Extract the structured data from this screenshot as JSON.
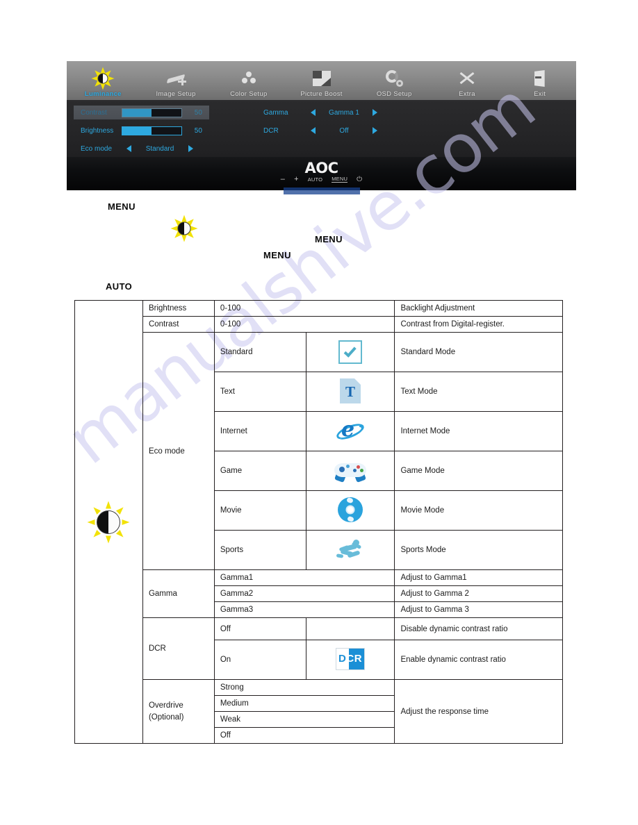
{
  "watermark": {
    "text": "manualshive.com"
  },
  "osd": {
    "tabs": [
      {
        "label": "Luminance",
        "icon": "luminance-sun-icon",
        "active": true
      },
      {
        "label": "Image Setup",
        "icon": "image-setup-icon",
        "active": false
      },
      {
        "label": "Color Setup",
        "icon": "color-setup-icon",
        "active": false
      },
      {
        "label": "Picture Boost",
        "icon": "picture-boost-icon",
        "active": false
      },
      {
        "label": "OSD Setup",
        "icon": "osd-setup-gear-icon",
        "active": false
      },
      {
        "label": "Extra",
        "icon": "extra-tools-icon",
        "active": false
      },
      {
        "label": "Exit",
        "icon": "exit-door-icon",
        "active": false
      }
    ],
    "left_column": {
      "contrast": {
        "label": "Contrast",
        "value": "50",
        "fill_percent": 50,
        "selected": true
      },
      "brightness": {
        "label": "Brightness",
        "value": "50",
        "fill_percent": 50,
        "selected": false
      },
      "eco_mode": {
        "label": "Eco mode",
        "value": "Standard",
        "selected": false
      }
    },
    "right_column": {
      "gamma": {
        "label": "Gamma",
        "value": "Gamma 1"
      },
      "dcr": {
        "label": "DCR",
        "value": "Off"
      }
    },
    "accent_color": "#2ea9e0"
  },
  "bezel": {
    "logo": "AOC",
    "buttons": [
      "–",
      "+",
      "AUTO",
      "MENU",
      "⏻"
    ]
  },
  "body_keywords": {
    "menu_1": "MENU",
    "menu_2": "MENU",
    "menu_3": "MENU",
    "auto_1": "AUTO"
  },
  "table": {
    "icon_cell": "luminance-sun-icon",
    "rows": [
      {
        "feature": "Brightness",
        "option": "0-100",
        "pic": null,
        "desc": "Backlight Adjustment"
      },
      {
        "feature": "Contrast",
        "option": "0-100",
        "pic": null,
        "desc": "Contrast from Digital-register."
      },
      {
        "feature": "Eco mode",
        "option": "Standard",
        "pic": "standard-check-icon",
        "desc": "Standard Mode"
      },
      {
        "feature": "",
        "option": "Text",
        "pic": "text-document-icon",
        "desc": "Text Mode"
      },
      {
        "feature": "",
        "option": "Internet",
        "pic": "internet-explorer-icon",
        "desc": "Internet Mode"
      },
      {
        "feature": "",
        "option": "Game",
        "pic": "gamepad-icon",
        "desc": "Game Mode"
      },
      {
        "feature": "",
        "option": "Movie",
        "pic": "movie-disc-icon",
        "desc": "Movie Mode"
      },
      {
        "feature": "",
        "option": "Sports",
        "pic": "sports-runner-icon",
        "desc": "Sports Mode"
      },
      {
        "feature": "Gamma",
        "option": "Gamma1",
        "pic": null,
        "desc": "Adjust to Gamma1"
      },
      {
        "feature": "",
        "option": "Gamma2",
        "pic": null,
        "desc": "Adjust to Gamma 2"
      },
      {
        "feature": "",
        "option": "Gamma3",
        "pic": null,
        "desc": "Adjust to Gamma 3"
      },
      {
        "feature": "DCR",
        "option": "Off",
        "pic": null,
        "desc": "Disable dynamic contrast ratio"
      },
      {
        "feature": "",
        "option": "On",
        "pic": "dcr-badge-icon",
        "desc": "Enable dynamic contrast ratio"
      },
      {
        "feature": "Overdrive (Optional)",
        "option": "Strong",
        "pic": null,
        "desc": "Adjust the response time"
      },
      {
        "feature": "",
        "option": "Medium",
        "pic": null,
        "desc": ""
      },
      {
        "feature": "",
        "option": "Weak",
        "pic": null,
        "desc": ""
      },
      {
        "feature": "",
        "option": "Off",
        "pic": null,
        "desc": ""
      }
    ],
    "labels": {
      "brightness": "Brightness",
      "contrast": "Contrast",
      "eco_mode": "Eco mode",
      "gamma": "Gamma",
      "dcr": "DCR",
      "overdrive_line1": "Overdrive",
      "overdrive_line2": "(Optional)",
      "range_0_100_a": "0-100",
      "range_0_100_b": "0-100",
      "standard": "Standard",
      "text": "Text",
      "internet": "Internet",
      "game": "Game",
      "movie": "Movie",
      "sports": "Sports",
      "gamma1": "Gamma1",
      "gamma2": "Gamma2",
      "gamma3": "Gamma3",
      "dcr_off": "Off",
      "dcr_on": "On",
      "strong": "Strong",
      "medium": "Medium",
      "weak": "Weak",
      "od_off": "Off",
      "desc_backlight": "Backlight Adjustment",
      "desc_contrast": "Contrast from Digital-register.",
      "desc_standard": "Standard Mode",
      "desc_text": "Text Mode",
      "desc_internet": "Internet Mode",
      "desc_game": "Game Mode",
      "desc_movie": "Movie Mode",
      "desc_sports": "Sports Mode",
      "desc_gamma1": "Adjust to Gamma1",
      "desc_gamma2": "Adjust to Gamma 2",
      "desc_gamma3": "Adjust to Gamma 3",
      "desc_dcr_off": "Disable dynamic contrast ratio",
      "desc_dcr_on": "Enable dynamic contrast ratio",
      "desc_overdrive": "Adjust the response time"
    },
    "dcr_badge_text_a": "D",
    "dcr_badge_text_b": "C",
    "dcr_badge_text_c": "R",
    "text_icon_letter": "T",
    "ie_icon_letter": "e"
  }
}
